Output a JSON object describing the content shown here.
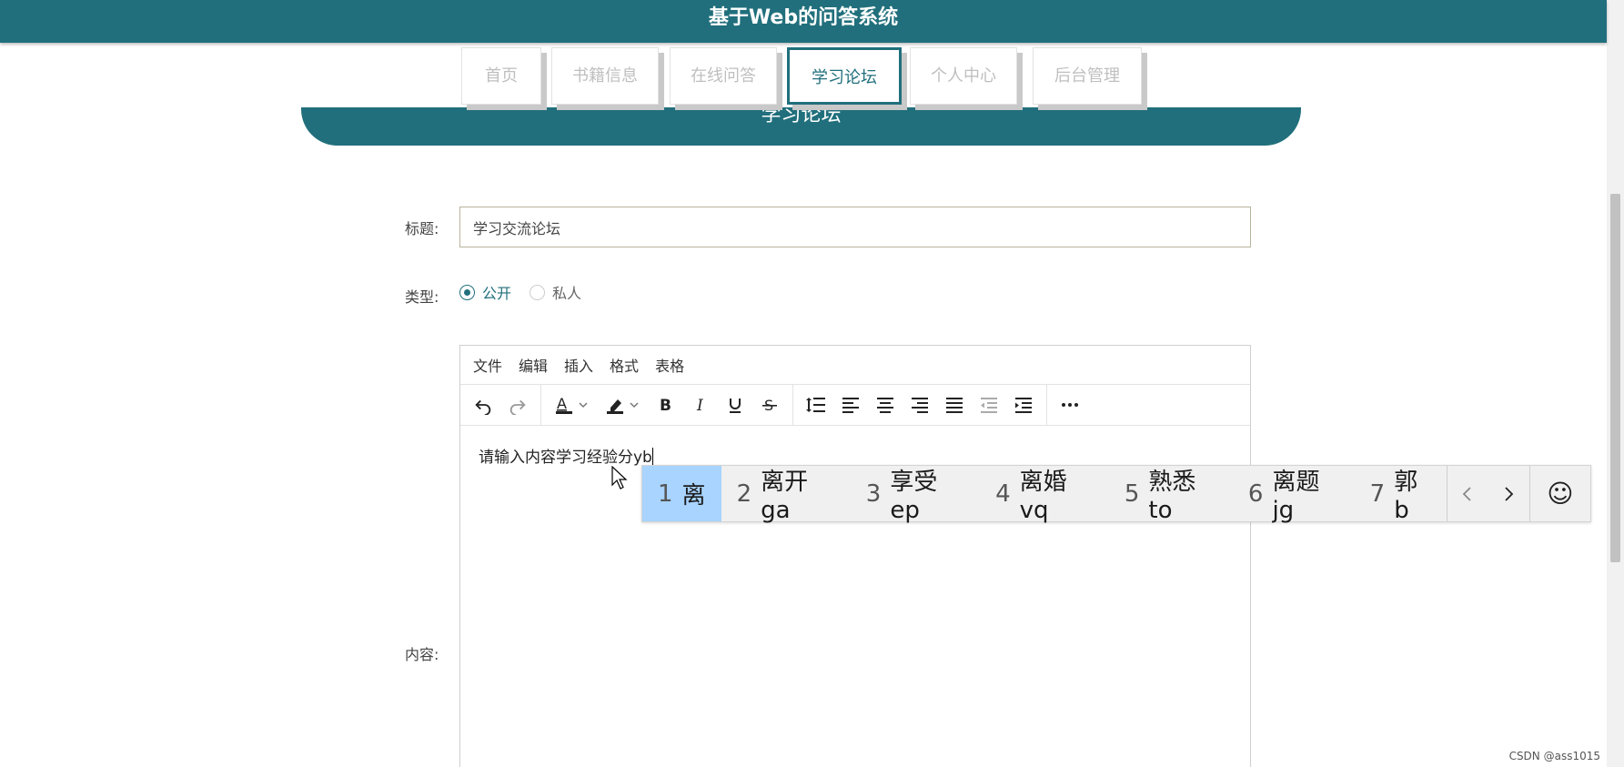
{
  "header": {
    "title": "基于Web的问答系统"
  },
  "nav": {
    "items": [
      {
        "label": "首页"
      },
      {
        "label": "书籍信息"
      },
      {
        "label": "在线问答"
      },
      {
        "label": "学习论坛"
      },
      {
        "label": "个人中心"
      },
      {
        "label": "后台管理"
      }
    ],
    "active": "学习论坛"
  },
  "section": {
    "title": "学习论坛"
  },
  "form": {
    "title_label": "标题:",
    "title_value": "学习交流论坛",
    "type_label": "类型:",
    "type_options": [
      "公开",
      "私人"
    ],
    "type_selected": "公开",
    "content_label": "内容:"
  },
  "editor": {
    "menus": [
      "文件",
      "编辑",
      "插入",
      "格式",
      "表格"
    ],
    "content_text": "请输入内容学习经验分yb",
    "toolbar_icons": [
      "undo-icon",
      "redo-icon",
      "text-color-icon",
      "highlight-icon",
      "bold-icon",
      "italic-icon",
      "underline-icon",
      "strikethrough-icon",
      "line-height-icon",
      "align-left-icon",
      "align-center-icon",
      "align-right-icon",
      "align-justify-icon",
      "outdent-icon",
      "indent-icon",
      "more-icon"
    ]
  },
  "ime": {
    "candidates": [
      {
        "num": "1",
        "text": "离"
      },
      {
        "num": "2",
        "text": "离开ga"
      },
      {
        "num": "3",
        "text": "享受ep"
      },
      {
        "num": "4",
        "text": "离婚vq"
      },
      {
        "num": "5",
        "text": "熟悉to"
      },
      {
        "num": "6",
        "text": "离题jg"
      },
      {
        "num": "7",
        "text": "郭b"
      }
    ],
    "selected_index": 0,
    "emoji_glyph": "☺"
  },
  "watermark": "CSDN @ass1015",
  "colors": {
    "primary": "#216f7c",
    "ime_selected": "#a8d4ff"
  }
}
